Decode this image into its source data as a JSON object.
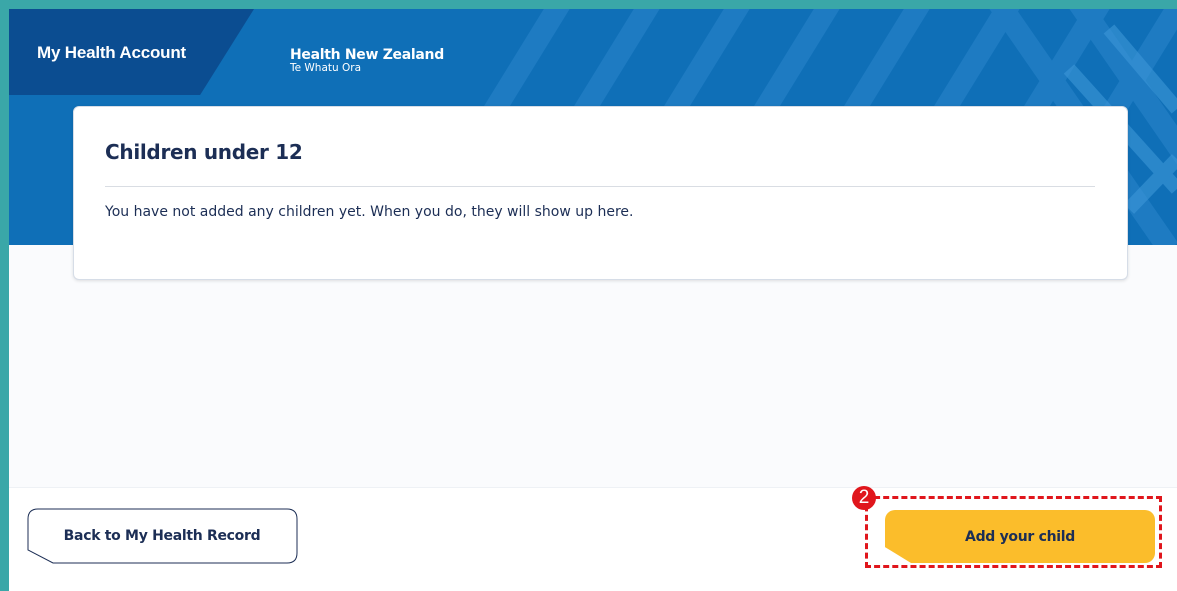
{
  "header": {
    "app_title": "My Health Account",
    "org_name": "Health New Zealand",
    "org_subname": "Te Whatu Ora"
  },
  "card": {
    "title": "Children under 12",
    "message": "You have not added any children yet. When you do, they will show up here."
  },
  "footer": {
    "back_label": "Back to My Health Record",
    "add_label": "Add your child"
  },
  "annotation": {
    "step_number": "2"
  },
  "colors": {
    "header_blue": "#0f6fb7",
    "brand_tab": "#0b4d91",
    "primary_button": "#fbbd2b",
    "text_navy": "#1c2e55",
    "annotation_red": "#e0161c",
    "frame_teal": "#3aa7a8"
  }
}
